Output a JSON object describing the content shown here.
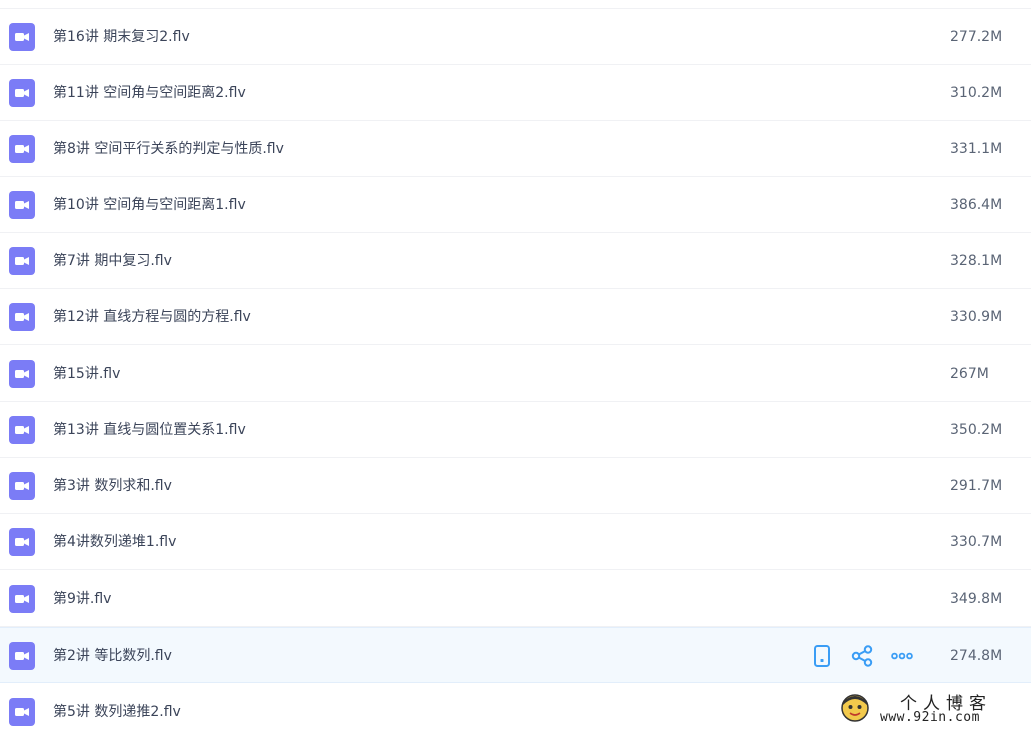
{
  "files": [
    {
      "name": "第16讲 期末复习2.flv",
      "size": "277.2M"
    },
    {
      "name": "第11讲 空间角与空间距离2.flv",
      "size": "310.2M"
    },
    {
      "name": "第8讲 空间平行关系的判定与性质.flv",
      "size": "331.1M"
    },
    {
      "name": "第10讲 空间角与空间距离1.flv",
      "size": "386.4M"
    },
    {
      "name": "第7讲 期中复习.flv",
      "size": "328.1M"
    },
    {
      "name": "第12讲 直线方程与圆的方程.flv",
      "size": "330.9M"
    },
    {
      "name": "第15讲.flv",
      "size": "267M"
    },
    {
      "name": "第13讲 直线与圆位置关系1.flv",
      "size": "350.2M"
    },
    {
      "name": "第3讲 数列求和.flv",
      "size": "291.7M"
    },
    {
      "name": "第4讲数列递堆1.flv",
      "size": "330.7M"
    },
    {
      "name": "第9讲.flv",
      "size": "349.8M"
    },
    {
      "name": "第2讲 等比数列.flv",
      "size": "274.8M"
    },
    {
      "name": "第5讲 数列递推2.flv",
      "size": ""
    }
  ],
  "hovered_row_icons": [
    "phone-icon",
    "share-icon",
    "more-icon"
  ],
  "file_type_icon": "video-file-icon",
  "colors": {
    "file_icon": "#7b7cf6",
    "action_icon": "#3a9df5",
    "hover_row_bg": "#f3f9fe"
  },
  "watermark": {
    "title": "个人博客",
    "url": "www.92in.com"
  }
}
